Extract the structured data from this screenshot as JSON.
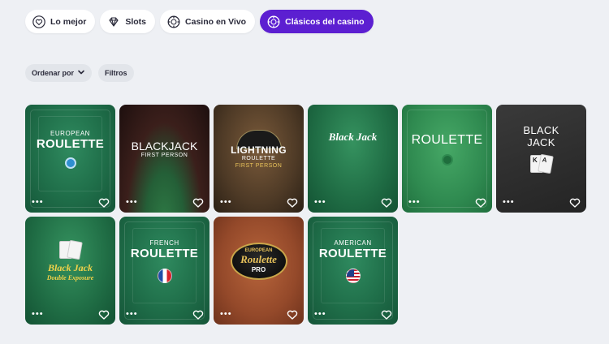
{
  "tabs": [
    {
      "label": "Lo mejor",
      "icon": "heart-icon",
      "active": false
    },
    {
      "label": "Slots",
      "icon": "diamond-icon",
      "active": false
    },
    {
      "label": "Casino en Vivo",
      "icon": "chip-icon",
      "active": false
    },
    {
      "label": "Clásicos del casino",
      "icon": "chip-icon",
      "active": true
    }
  ],
  "filters": {
    "sort_label": "Ordenar por",
    "filter_label": "Filtros"
  },
  "games": [
    {
      "line1": "EUROPEAN",
      "line2": "ROULETTE"
    },
    {
      "line1": "BLACKJACK",
      "line2": "FIRST PERSON"
    },
    {
      "line1": "LIGHTNING",
      "line2": "ROULETTE",
      "line3": "FIRST PERSON"
    },
    {
      "line1": "Black Jack"
    },
    {
      "line1": "ROULETTE"
    },
    {
      "line1": "BLACK",
      "line2": "JACK",
      "card1": "K",
      "card2": "A"
    },
    {
      "line1": "Black Jack",
      "line2": "Double Exposure"
    },
    {
      "line1": "FRENCH",
      "line2": "ROULETTE"
    },
    {
      "line1": "EUROPEAN",
      "line2": "Roulette",
      "line3": "PRO"
    },
    {
      "line1": "AMERICAN",
      "line2": "ROULETTE"
    }
  ],
  "card_actions": {
    "more": "•••"
  },
  "colors": {
    "accent": "#5c1fd1",
    "background": "#eef0f4",
    "felt": "#1f6e49"
  }
}
